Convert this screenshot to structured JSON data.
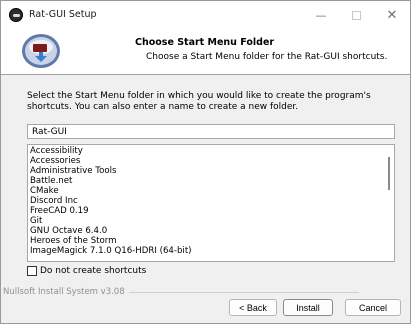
{
  "window": {
    "title": "Rat-GUI Setup",
    "minimize_glyph": "—",
    "close_glyph": "✕"
  },
  "header": {
    "title": "Choose Start Menu Folder",
    "subtitle": "Choose a Start Menu folder for the Rat-GUI shortcuts."
  },
  "intro": {
    "text": "Select the Start Menu folder in which you would like to create the program's shortcuts. You can also enter a name to create a new folder."
  },
  "folder_input": {
    "value": "Rat-GUI"
  },
  "folder_list": {
    "items": [
      "Accessibility",
      "Accessories",
      "Administrative Tools",
      "Battle.net",
      "CMake",
      "Discord Inc",
      "FreeCAD 0.19",
      "Git",
      "GNU Octave 6.4.0",
      "Heroes of the Storm",
      "ImageMagick 7.1.0 Q16-HDRI (64-bit)"
    ]
  },
  "no_shortcuts": {
    "label": "Do not create shortcuts",
    "checked": false
  },
  "footer": {
    "branding": "Nullsoft Install System v3.08"
  },
  "buttons": {
    "back": "< Back",
    "install": "Install",
    "cancel": "Cancel"
  },
  "colors": {
    "background": "#f0f0f0",
    "header_bg": "#ffffff"
  }
}
